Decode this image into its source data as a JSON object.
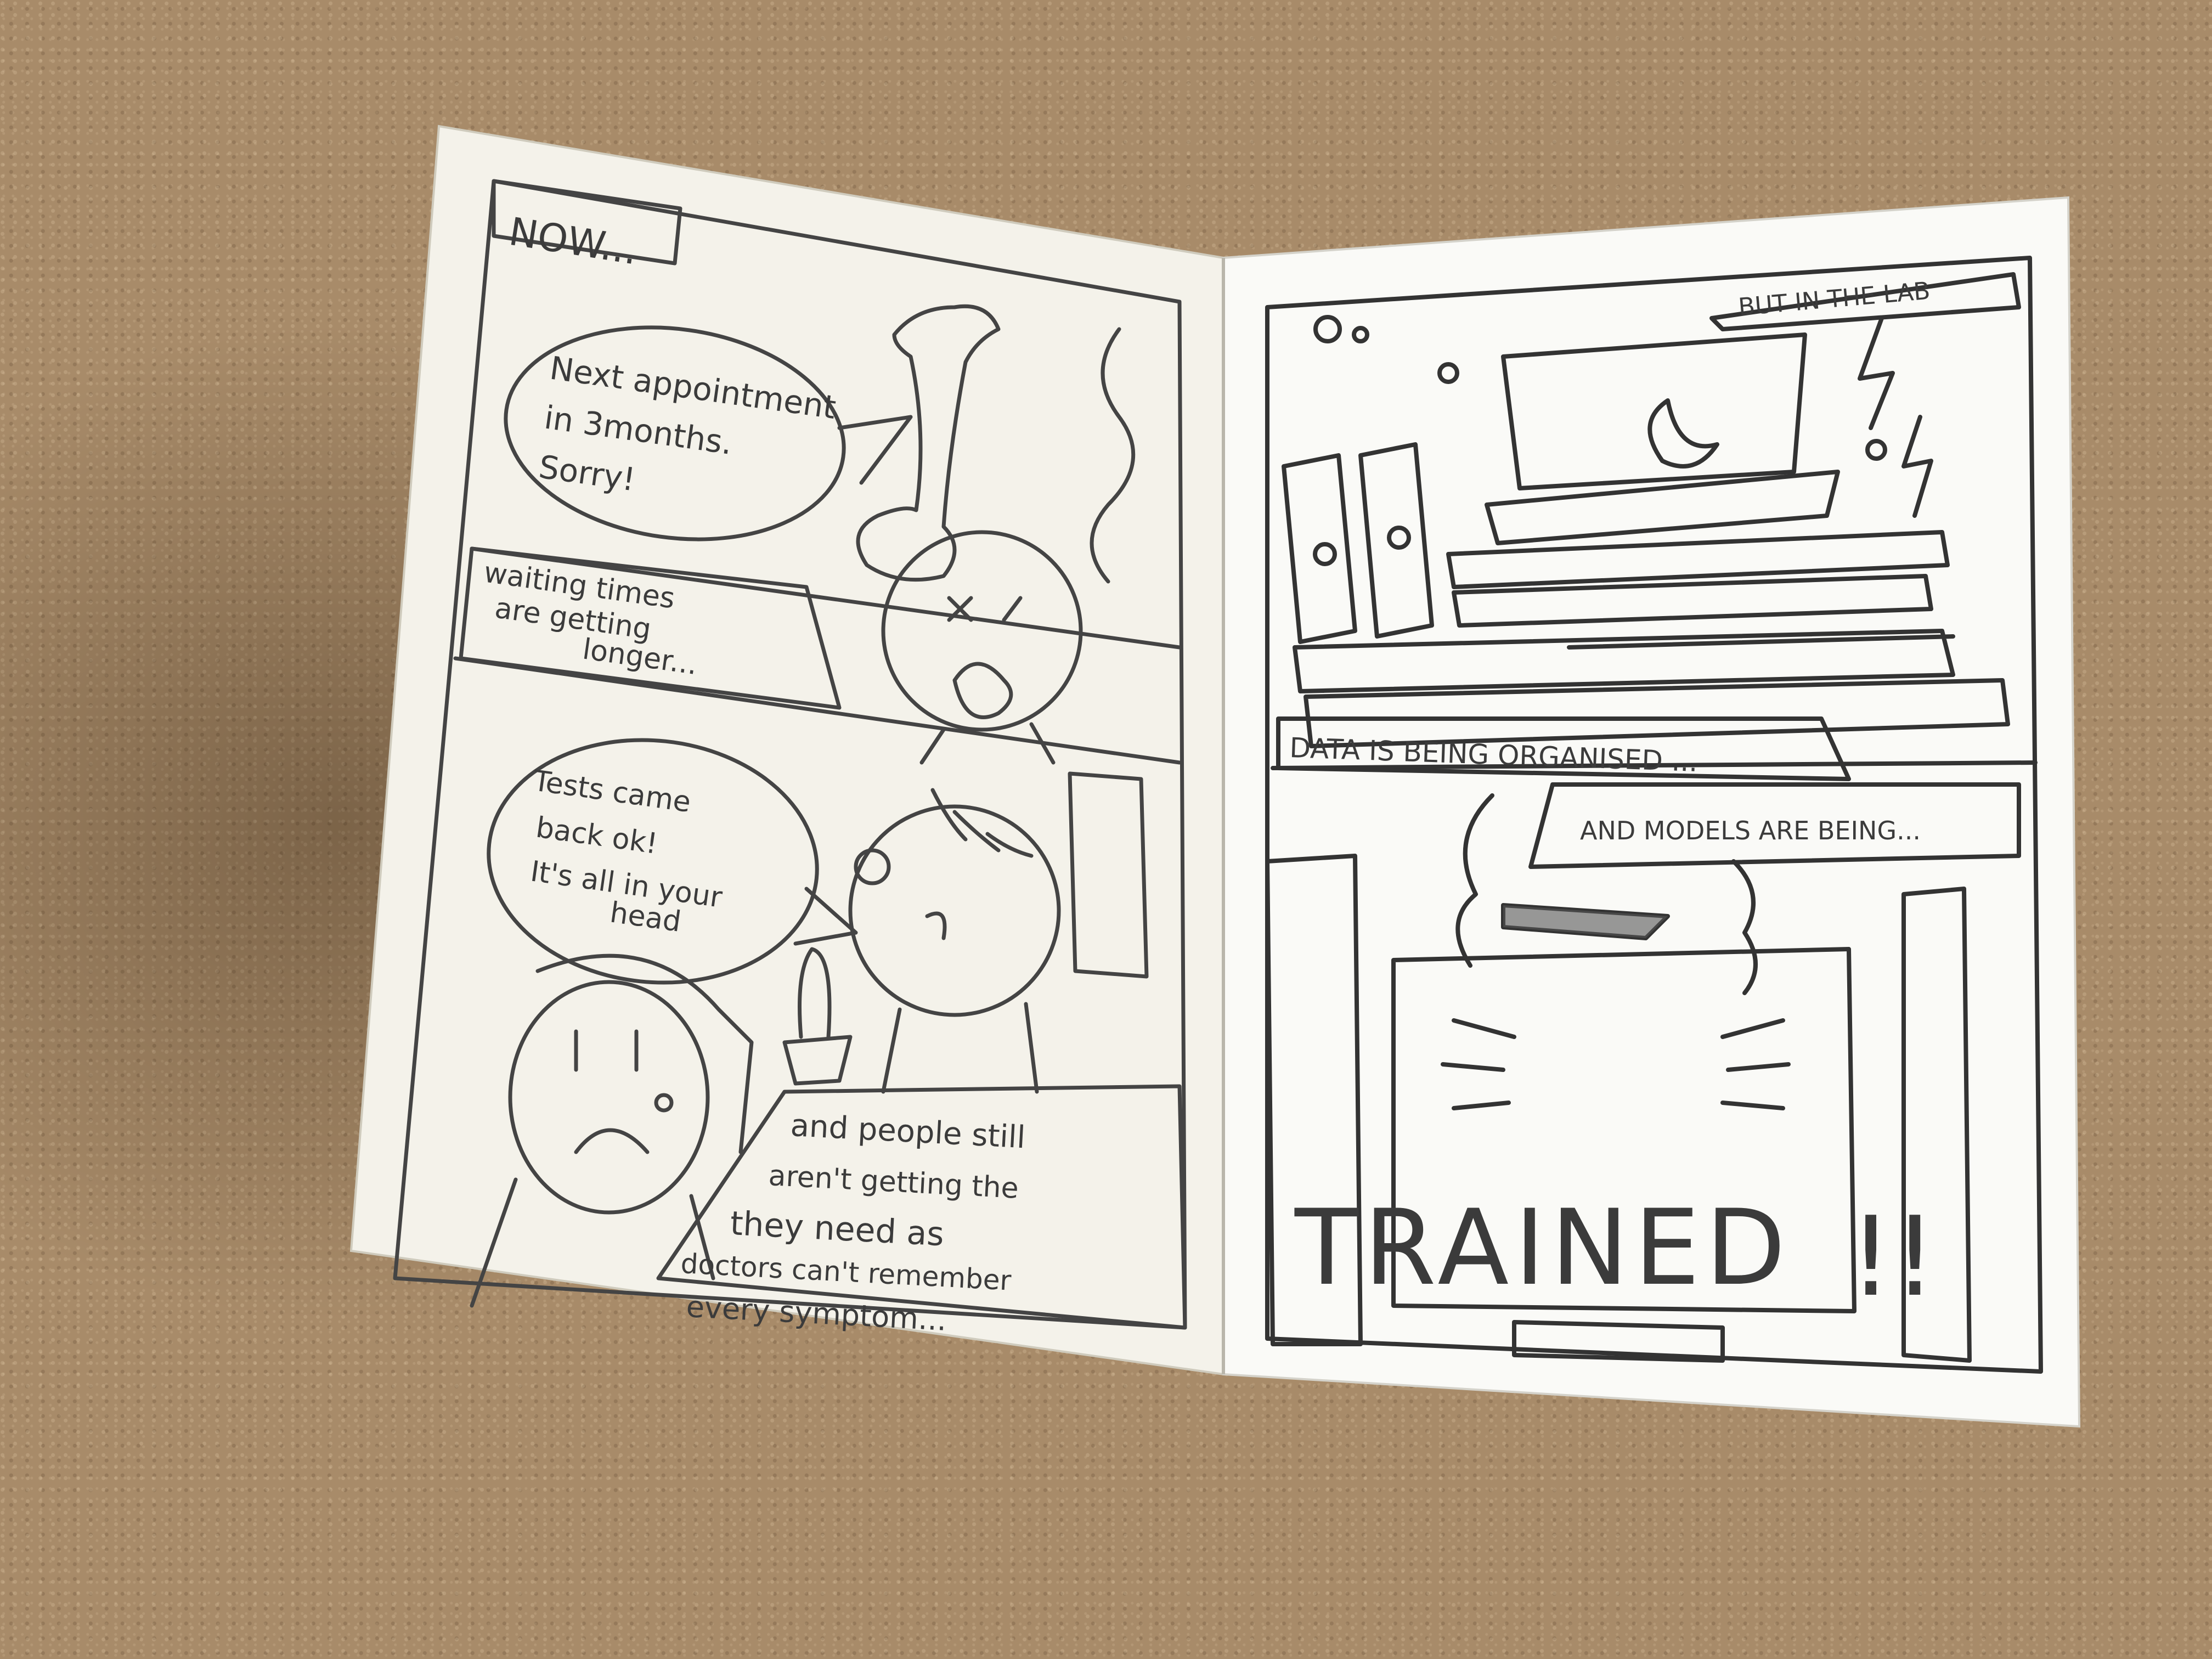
{
  "left_page": {
    "caption_now": "NOW...",
    "phone_bubble": [
      "Next appointment",
      "in 3months.",
      "Sorry!"
    ],
    "caption_waiting": [
      "waiting times",
      "are getting",
      "longer..."
    ],
    "doctor_bubble": [
      "Tests came",
      "back ok!",
      "It's all in your",
      "head"
    ],
    "caption_people": [
      "and people still",
      "aren't getting the",
      "they need as",
      "doctors can't remember",
      "every symptom..."
    ]
  },
  "right_page": {
    "caption_lab": "BUT IN THE LAB",
    "caption_data": "DATA IS BEING ORGANISED ...",
    "caption_models": "AND MODELS ARE BEING...",
    "trained": "TRAINED",
    "exclaim": "!!"
  }
}
